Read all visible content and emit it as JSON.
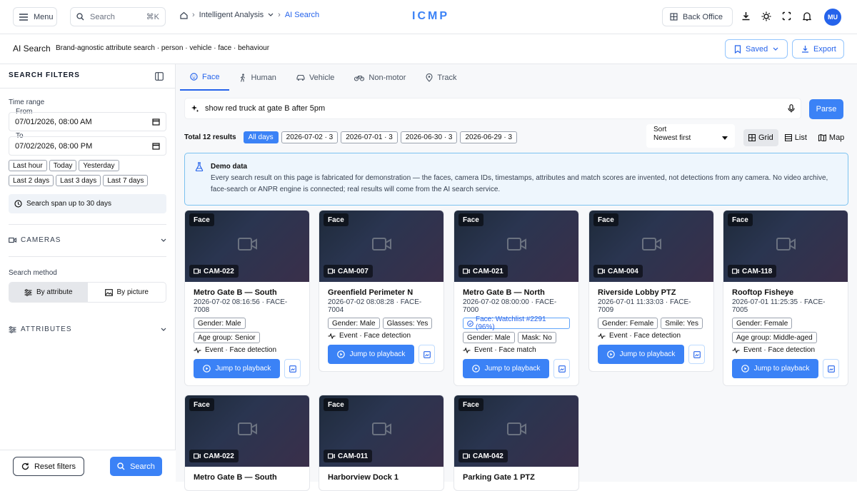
{
  "topbar": {
    "menu_label": "Menu",
    "search_label": "Search",
    "search_shortcut": "⌘K",
    "breadcrumb": [
      "Intelligent Analysis",
      "AI Search"
    ],
    "logo": "ICMP",
    "back_office_label": "Back Office",
    "avatar_initials": "MU"
  },
  "subheader": {
    "title": "AI Search",
    "subtitle": "Brand-agnostic attribute search · person · vehicle · face · behaviour",
    "saved_label": "Saved",
    "export_label": "Export"
  },
  "sidebar": {
    "title": "SEARCH FILTERS",
    "time_range_label": "Time range",
    "from_label": "From",
    "from_value": "07/01/2026, 08:00 AM",
    "to_label": "To",
    "to_value": "07/02/2026, 08:00 PM",
    "quick_ranges": [
      "Last hour",
      "Today",
      "Yesterday",
      "Last 2 days",
      "Last 3 days",
      "Last 7 days"
    ],
    "span_note": "Search span up to 30 days",
    "cameras_label": "CAMERAS",
    "search_method_label": "Search method",
    "method_attribute": "By attribute",
    "method_picture": "By picture",
    "attributes_label": "ATTRIBUTES",
    "reset_label": "Reset filters",
    "search_label": "Search"
  },
  "main": {
    "tabs": [
      "Face",
      "Human",
      "Vehicle",
      "Non-motor",
      "Track"
    ],
    "query": "show red truck at gate B after 5pm",
    "parse_label": "Parse",
    "total_results": "Total 12 results",
    "date_chips": [
      "All days",
      "2026-07-02 · 3",
      "2026-07-01 · 3",
      "2026-06-30 · 3",
      "2026-06-29 · 3"
    ],
    "sort_label": "Sort",
    "sort_value": "Newest first",
    "views": [
      "Grid",
      "List",
      "Map"
    ],
    "demo_title": "Demo data",
    "demo_text": "Every search result on this page is fabricated for demonstration — the faces, camera IDs, timestamps, attributes and match scores are invented, not detections from any camera. No video archive, face-search or ANPR engine is connected; real results will come from the AI search service."
  },
  "cards": [
    {
      "type": "Face",
      "cam": "CAM-022",
      "title": "Metro Gate B — South",
      "sub": "2026-07-02 08:16:56 · FACE-7008",
      "tags": [
        "Gender: Male",
        "Age group: Senior"
      ],
      "event": "Event · Face detection",
      "jump": "Jump to playback"
    },
    {
      "type": "Face",
      "cam": "CAM-007",
      "title": "Greenfield Perimeter N",
      "sub": "2026-07-02 08:08:28 · FACE-7004",
      "tags": [
        "Gender: Male",
        "Glasses: Yes"
      ],
      "event": "Event · Face detection",
      "jump": "Jump to playback"
    },
    {
      "type": "Face",
      "cam": "CAM-021",
      "title": "Metro Gate B — North",
      "sub": "2026-07-02 08:00:00 · FACE-7000",
      "watchlist": "Face: Watchlist #2291 (96%)",
      "tags": [
        "Gender: Male",
        "Mask: No"
      ],
      "event": "Event · Face match",
      "jump": "Jump to playback"
    },
    {
      "type": "Face",
      "cam": "CAM-004",
      "title": "Riverside Lobby PTZ",
      "sub": "2026-07-01 11:33:03 · FACE-7009",
      "tags": [
        "Gender: Female",
        "Smile: Yes"
      ],
      "event": "Event · Face detection",
      "jump": "Jump to playback"
    },
    {
      "type": "Face",
      "cam": "CAM-118",
      "title": "Rooftop Fisheye",
      "sub": "2026-07-01 11:25:35 · FACE-7005",
      "tags": [
        "Gender: Female",
        "Age group: Middle-aged"
      ],
      "event": "Event · Face detection",
      "jump": "Jump to playback"
    },
    {
      "type": "Face",
      "cam": "CAM-022",
      "title": "Metro Gate B — South"
    },
    {
      "type": "Face",
      "cam": "CAM-011",
      "title": "Harborview Dock 1"
    },
    {
      "type": "Face",
      "cam": "CAM-042",
      "title": "Parking Gate 1 PTZ"
    }
  ],
  "colors": {
    "accent": "#3b82f6",
    "demo_bg": "#eef6fd",
    "demo_border": "#7cc2f0"
  }
}
